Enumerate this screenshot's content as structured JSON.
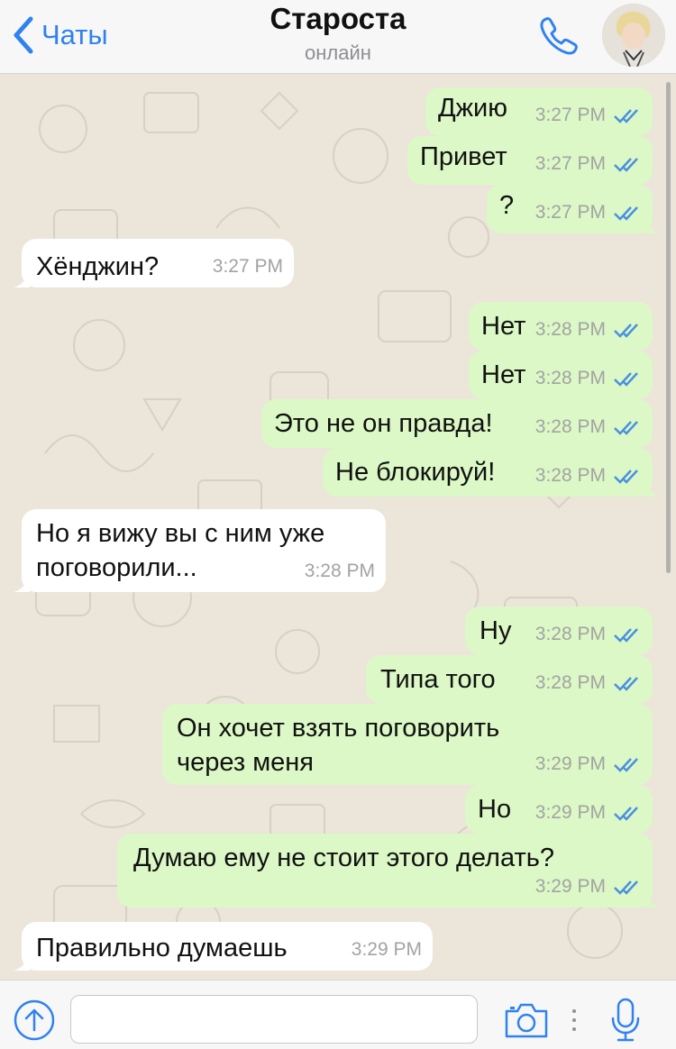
{
  "header": {
    "back_label": "Чаты",
    "title": "Староста",
    "status": "онлайн"
  },
  "messages": [
    {
      "dir": "out",
      "text": "Джию",
      "time": "3:27 PM",
      "read": true
    },
    {
      "dir": "out",
      "text": "Привет",
      "time": "3:27 PM",
      "read": true
    },
    {
      "dir": "out",
      "text": "?",
      "time": "3:27 PM",
      "read": true
    },
    {
      "dir": "in",
      "text": "Хёнджин?",
      "time": "3:27 PM"
    },
    {
      "dir": "out",
      "text": "Нет",
      "time": "3:28 PM",
      "read": true
    },
    {
      "dir": "out",
      "text": "Нет",
      "time": "3:28 PM",
      "read": true
    },
    {
      "dir": "out",
      "text": "Это не он правда!",
      "time": "3:28 PM",
      "read": true
    },
    {
      "dir": "out",
      "text": "Не блокируй!",
      "time": "3:28 PM",
      "read": true
    },
    {
      "dir": "in",
      "text": "Но я вижу вы с ним уже поговорили...",
      "time": "3:28 PM"
    },
    {
      "dir": "out",
      "text": "Ну",
      "time": "3:28 PM",
      "read": true
    },
    {
      "dir": "out",
      "text": "Типа того",
      "time": "3:28 PM",
      "read": true
    },
    {
      "dir": "out",
      "text": "Он хочет взять поговорить через меня",
      "time": "3:29 PM",
      "read": true
    },
    {
      "dir": "out",
      "text": "Но",
      "time": "3:29 PM",
      "read": true
    },
    {
      "dir": "out",
      "text": "Думаю ему не стоит этого делать?",
      "time": "3:29 PM",
      "read": true
    },
    {
      "dir": "in",
      "text": "Правильно думаешь",
      "time": "3:29 PM"
    }
  ],
  "composer": {
    "value": "",
    "placeholder": ""
  },
  "icons": {
    "back": "chevron-left-icon",
    "call": "phone-icon",
    "attach": "upload-arrow-icon",
    "camera": "camera-icon",
    "mic": "microphone-icon"
  },
  "colors": {
    "accent": "#2f82f0",
    "outgoing_bubble": "#dcf8c6",
    "incoming_bubble": "#ffffff",
    "read_ticks": "#4a90e2",
    "chat_background": "#ebe5da"
  }
}
